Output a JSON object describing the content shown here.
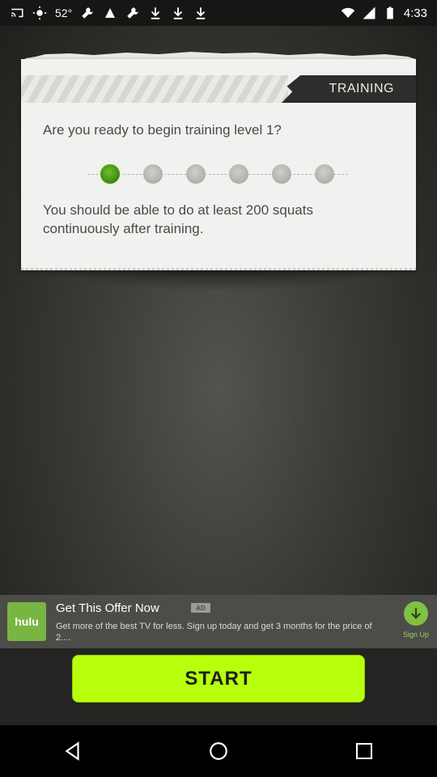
{
  "status_bar": {
    "temperature": "52°",
    "time": "4:33",
    "icons": [
      "cast-icon",
      "sun-icon",
      "wrench-icon",
      "flag-icon",
      "wrench-icon",
      "download-icon",
      "download-icon",
      "download-icon",
      "wifi-icon",
      "signal-icon",
      "battery-icon"
    ]
  },
  "card": {
    "tab_label": "TRAINING",
    "question": "Are you ready to begin training level 1?",
    "levels": {
      "total": 6,
      "current": 1
    },
    "description": "You should be able to do at least 200 squats continuously after training."
  },
  "ad": {
    "logo_text": "hulu",
    "title": "Get This Offer Now",
    "badge": "AD",
    "text": "Get more of the best TV for less. Sign up today and get 3 months for the price of 2....",
    "signup_label": "Sign Up",
    "accent_color": "#7fc142"
  },
  "start_label": "START",
  "colors": {
    "start_button": "#b7ff0a",
    "active_level": "#3f8a12"
  },
  "nav": [
    "back-icon",
    "home-icon",
    "recent-apps-icon"
  ]
}
